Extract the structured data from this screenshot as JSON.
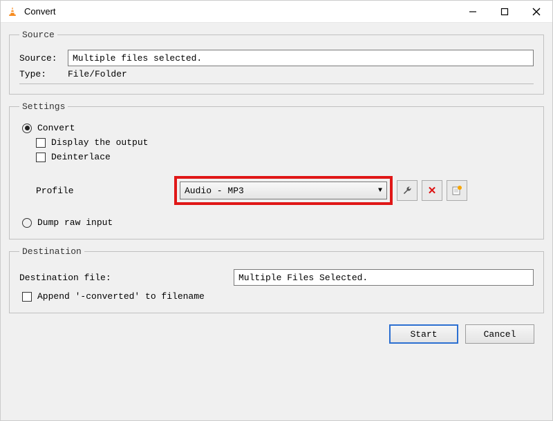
{
  "window": {
    "title": "Convert",
    "minimize_aria": "Minimize",
    "maximize_aria": "Maximize",
    "close_aria": "Close"
  },
  "source": {
    "legend": "Source",
    "source_label": "Source:",
    "source_value": "Multiple files selected.",
    "type_label": "Type:",
    "type_value": "File/Folder"
  },
  "settings": {
    "legend": "Settings",
    "convert_label": "Convert",
    "display_output_label": "Display the output",
    "deinterlace_label": "Deinterlace",
    "profile_label": "Profile",
    "profile_selected": "Audio - MP3",
    "wrench_aria": "Edit profile",
    "delete_aria": "Delete profile",
    "new_aria": "New profile",
    "dump_raw_label": "Dump raw input"
  },
  "destination": {
    "legend": "Destination",
    "file_label": "Destination file:",
    "file_value": "Multiple Files Selected.",
    "append_label": "Append '-converted' to filename"
  },
  "buttons": {
    "start": "Start",
    "cancel": "Cancel"
  },
  "highlight_color": "#e01717"
}
